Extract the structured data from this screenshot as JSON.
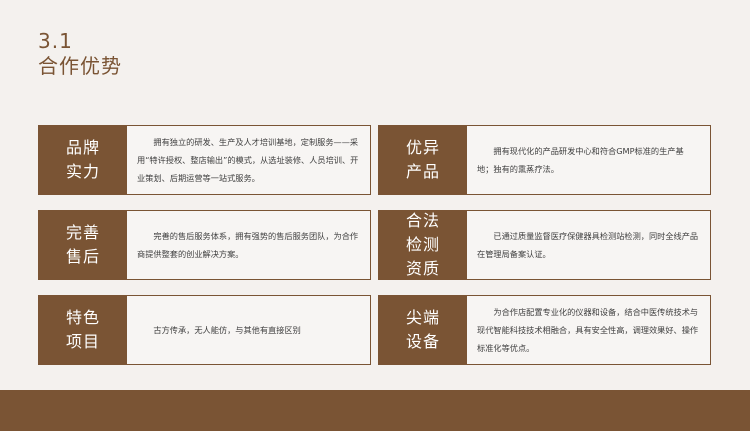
{
  "header": {
    "section_number": "3.1",
    "title": "合作优势"
  },
  "cards": [
    {
      "label": "品牌\n实力",
      "desc": "拥有独立的研发、生产及人才培训基地，定制服务——采用“特许授权、整店输出”的模式，从选址装修、人员培训、开业策划、后期运营等一站式服务。"
    },
    {
      "label": "优异\n产品",
      "desc": "拥有现代化的产品研发中心和符合GMP标准的生产基地；独有的熏蒸疗法。"
    },
    {
      "label": "完善\n售后",
      "desc": "完善的售后服务体系，拥有强势的售后服务团队，为合作商提供整套的创业解决方案。"
    },
    {
      "label": "合法\n检测\n资质",
      "desc": "已通过质量监督医疗保健器具检测站检测，同时全线产品在管理局备案认证。"
    },
    {
      "label": "特色\n项目",
      "desc": "古方传承，无人能仿，与其他有直接区别"
    },
    {
      "label": "尖端\n设备",
      "desc": "为合作店配置专业化的仪器和设备，结合中医传统技术与现代智能科技技术相融合，具有安全性高，调理效果好、操作标准化等优点。"
    }
  ],
  "colors": {
    "brand": "#7a5434",
    "background": "#f4f1ee"
  }
}
